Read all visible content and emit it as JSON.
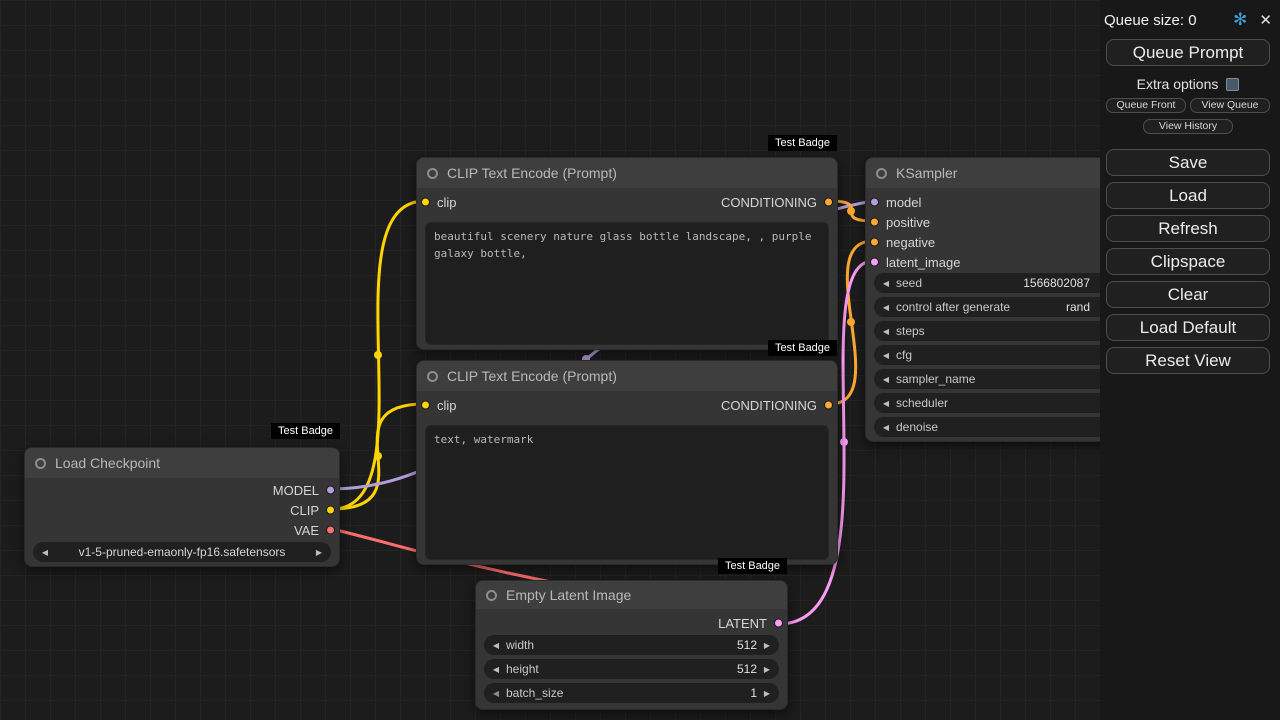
{
  "badge_label": "Test Badge",
  "colors": {
    "model": "#B39DDB",
    "clip": "#FFD500",
    "vae": "#FF6E6E",
    "conditioning": "#FFA931",
    "latent": "#FF9CF9"
  },
  "nodes": {
    "load_checkpoint": {
      "title": "Load Checkpoint",
      "outputs": [
        "MODEL",
        "CLIP",
        "VAE"
      ],
      "ckpt_name": "v1-5-pruned-emaonly-fp16.safetensors"
    },
    "clip_positive": {
      "title": "CLIP Text Encode (Prompt)",
      "input_label": "clip",
      "output_label": "CONDITIONING",
      "text": "beautiful scenery nature glass bottle landscape, , purple galaxy bottle,"
    },
    "clip_negative": {
      "title": "CLIP Text Encode (Prompt)",
      "input_label": "clip",
      "output_label": "CONDITIONING",
      "text": "text, watermark"
    },
    "ksampler": {
      "title": "KSampler",
      "inputs": [
        "model",
        "positive",
        "negative",
        "latent_image"
      ],
      "widgets": [
        {
          "label": "seed",
          "value": "1566802087"
        },
        {
          "label": "control after generate",
          "value": "rand"
        },
        {
          "label": "steps",
          "value": ""
        },
        {
          "label": "cfg",
          "value": ""
        },
        {
          "label": "sampler_name",
          "value": ""
        },
        {
          "label": "scheduler",
          "value": ""
        },
        {
          "label": "denoise",
          "value": ""
        }
      ]
    },
    "empty_latent": {
      "title": "Empty Latent Image",
      "output_label": "LATENT",
      "widgets": [
        {
          "label": "width",
          "value": "512"
        },
        {
          "label": "height",
          "value": "512"
        },
        {
          "label": "batch_size",
          "value": "1"
        }
      ]
    }
  },
  "menu": {
    "queue_size": "Queue size: 0",
    "queue_prompt": "Queue Prompt",
    "extra_options": "Extra options",
    "queue_front": "Queue Front",
    "view_queue": "View Queue",
    "view_history": "View History",
    "buttons": [
      "Save",
      "Load",
      "Refresh",
      "Clipspace",
      "Clear",
      "Load Default",
      "Reset View"
    ]
  }
}
